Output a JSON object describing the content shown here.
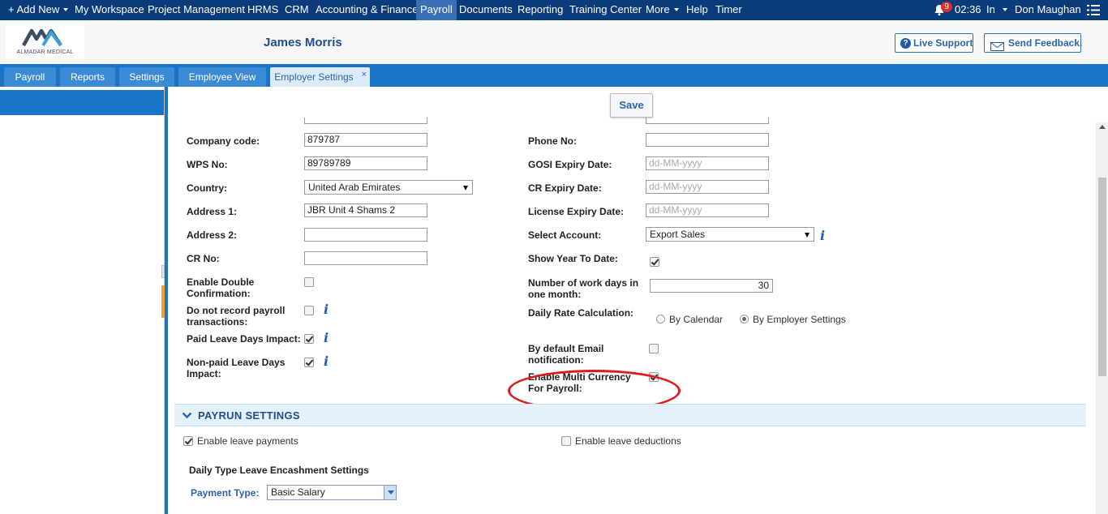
{
  "topnav": {
    "add_new": "+ Add New",
    "items": [
      "My Workspace",
      "Project Management",
      "HRMS",
      "CRM",
      "Accounting & Finance",
      "Payroll",
      "Documents",
      "Reporting",
      "Training Center",
      "More",
      "Help",
      "Timer"
    ],
    "notification_count": "9",
    "time": "02:36",
    "status": "In",
    "user": "Don Maughan"
  },
  "header": {
    "logo_text": "ALMADAR MEDICAL",
    "employee_name": "James Morris",
    "live_support": "Live Support",
    "send_feedback": "Send Feedback."
  },
  "tabs": [
    "Payroll",
    "Reports",
    "Settings",
    "Employee View",
    "Employer Settings"
  ],
  "save_label": "Save",
  "left": {
    "company_code_label": "Company code:",
    "company_code": "879787",
    "wps_label": "WPS No:",
    "wps": "89789789",
    "country_label": "Country:",
    "country": "United Arab Emirates",
    "address1_label": "Address 1:",
    "address1": "JBR Unit 4 Shams 2",
    "address2_label": "Address 2:",
    "address2": "",
    "cr_label": "CR No:",
    "cr": "",
    "double_conf_label": "Enable Double Confirmation:",
    "no_record_label": "Do not record payroll transactions:",
    "paid_leave_label": "Paid Leave Days Impact:",
    "nonpaid_leave_label": "Non-paid Leave Days Impact:"
  },
  "right": {
    "phone_label": "Phone No:",
    "phone": "",
    "gosi_label": "GOSI Expiry Date:",
    "date_placeholder": "dd-MM-yyyy",
    "cr_expiry_label": "CR Expiry Date:",
    "license_label": "License Expiry Date:",
    "account_label": "Select Account:",
    "account": "Export Sales",
    "ytd_label": "Show Year To Date:",
    "workdays_label": "Number of work days in one month:",
    "workdays": "30",
    "daily_rate_label": "Daily Rate Calculation:",
    "by_calendar": "By Calendar",
    "by_employer": "By Employer Settings",
    "email_label": "By default Email notification:",
    "multi_currency_label": "Enable Multi Currency For Payroll:"
  },
  "payrun": {
    "title": "PAYRUN SETTINGS",
    "leave_payments": "Enable leave payments",
    "leave_deductions": "Enable leave deductions",
    "encash_title": "Daily Type Leave Encashment Settings",
    "payment_type_label": "Payment Type:",
    "payment_type": "Basic Salary"
  },
  "colors": {
    "nav": "#0a3b7a",
    "tabbar": "#1a73c4",
    "accent": "#2a64ad",
    "highlight_circle": "#e01b1b"
  }
}
